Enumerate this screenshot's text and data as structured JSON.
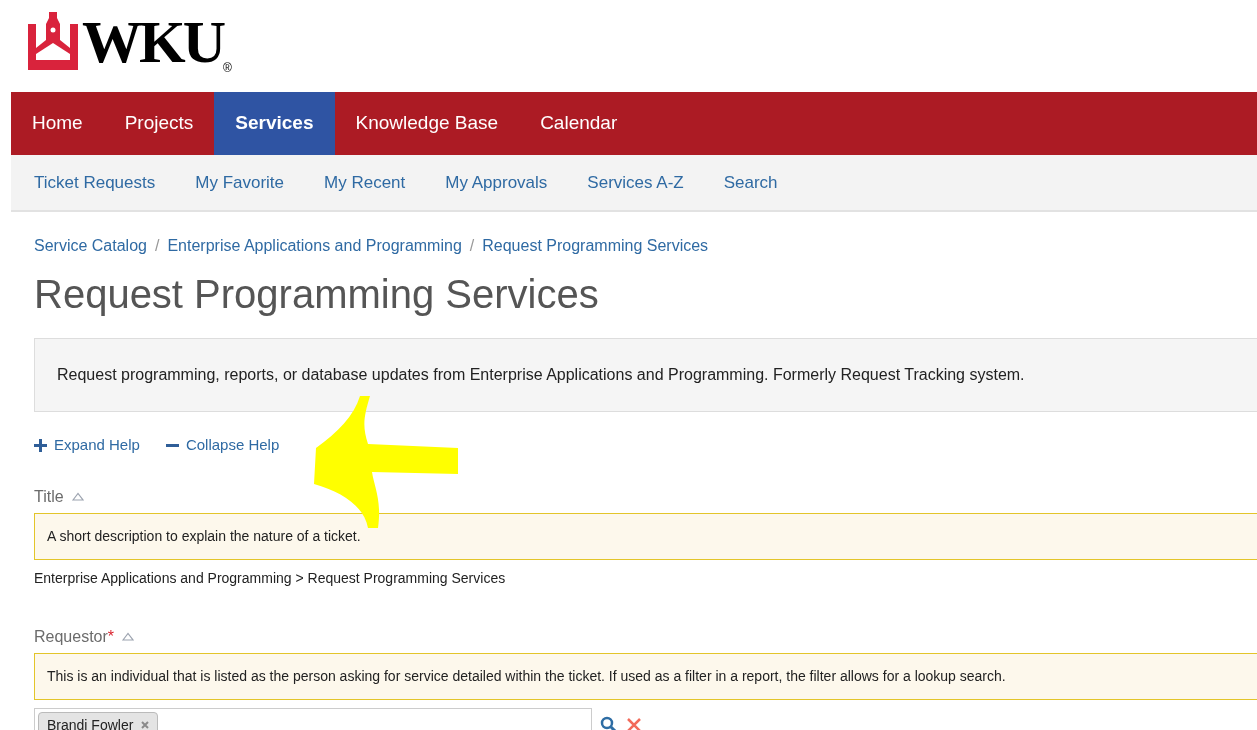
{
  "logo": {
    "text": "WKU",
    "mark": "®"
  },
  "main_nav": [
    {
      "label": "Home",
      "selected": false
    },
    {
      "label": "Projects",
      "selected": false
    },
    {
      "label": "Services",
      "selected": true
    },
    {
      "label": "Knowledge Base",
      "selected": false
    },
    {
      "label": "Calendar",
      "selected": false
    }
  ],
  "sub_nav": [
    "Ticket Requests",
    "My Favorite",
    "My Recent",
    "My Approvals",
    "Services A-Z",
    "Search"
  ],
  "breadcrumb": [
    {
      "kind": "link",
      "text": "Service Catalog"
    },
    {
      "kind": "separator",
      "text": "/"
    },
    {
      "kind": "link",
      "text": "Enterprise Applications and Programming"
    },
    {
      "kind": "separator",
      "text": "/"
    },
    {
      "kind": "link",
      "text": "Request Programming Services"
    }
  ],
  "heading": "Request Programming Services",
  "description": "Request programming, reports, or database updates from Enterprise Applications and Programming. Formerly Request Tracking system.",
  "help_links": [
    {
      "kind": "expand",
      "label": "Expand Help"
    },
    {
      "kind": "collapse",
      "label": "Collapse Help"
    }
  ],
  "fields": [
    {
      "kind": "text",
      "label": "Title",
      "expanded": true,
      "help": "A short description to explain the nature of a ticket.",
      "value": "Enterprise Applications and Programming > Request Programming Services"
    },
    {
      "kind": "person",
      "label": "Requestor",
      "required_mark": "*",
      "expanded": true,
      "help": "This is an individual that is listed as the person asking for service detailed within the ticket. If used as a filter in a report, the filter allows for a lookup search.",
      "tokens": [
        "Brandi Fowler"
      ]
    }
  ],
  "annotation": {
    "kind": "arrow"
  }
}
